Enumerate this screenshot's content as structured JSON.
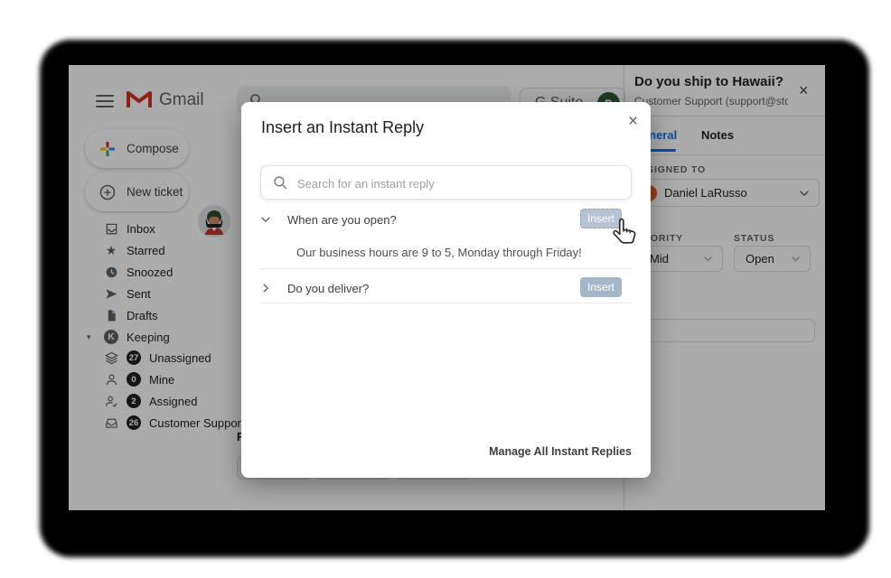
{
  "chrome": {
    "gmail_logo_text": "Gmail",
    "gsuite_label": "G Suite",
    "gsuite_avatar_letter": "D"
  },
  "sidebar": {
    "compose_label": "Compose",
    "new_ticket_label": "New ticket",
    "items": [
      {
        "label": "Inbox"
      },
      {
        "label": "Starred"
      },
      {
        "label": "Snoozed"
      },
      {
        "label": "Sent"
      },
      {
        "label": "Drafts"
      },
      {
        "label": "Keeping"
      }
    ],
    "keeping_icon_letter": "K",
    "keeping_items": [
      {
        "label": "Unassigned",
        "count": "27"
      },
      {
        "label": "Mine",
        "count": "0"
      },
      {
        "label": "Assigned",
        "count": "2"
      },
      {
        "label": "Customer Support",
        "count": "26"
      }
    ]
  },
  "background": {
    "partial_letter": "F"
  },
  "modal": {
    "title": "Insert an Instant Reply",
    "close_glyph": "×",
    "search_placeholder": "Search for an instant reply",
    "replies": [
      {
        "question": "When are you open?",
        "answer": "Our business hours are 9 to 5, Monday through Friday!",
        "insert_label": "Insert",
        "expanded": true
      },
      {
        "question": "Do you deliver?",
        "insert_label": "Insert",
        "expanded": false
      }
    ],
    "manage_link": "Manage All Instant Replies"
  },
  "ticket_panel": {
    "title": "Do you ship to Hawaii?",
    "subtitle": "Customer Support (support@stok...",
    "close_glyph": "×",
    "tabs": [
      {
        "label": "General",
        "active": true
      },
      {
        "label": "Notes",
        "active": false
      }
    ],
    "assigned_to_label": "ASSIGNED TO",
    "assignee": "Daniel LaRusso",
    "priority_label": "PRIORITY",
    "priority_value": "Mid",
    "status_label": "STATUS",
    "status_value": "Open"
  },
  "colors": {
    "insert_button": "#a4b7c9",
    "tab_active_blue": "#1a73e8",
    "gmail_red": "#d93025",
    "badge_bg": "#202124",
    "dim_overlay": "rgba(0,0,0,0.33)"
  }
}
